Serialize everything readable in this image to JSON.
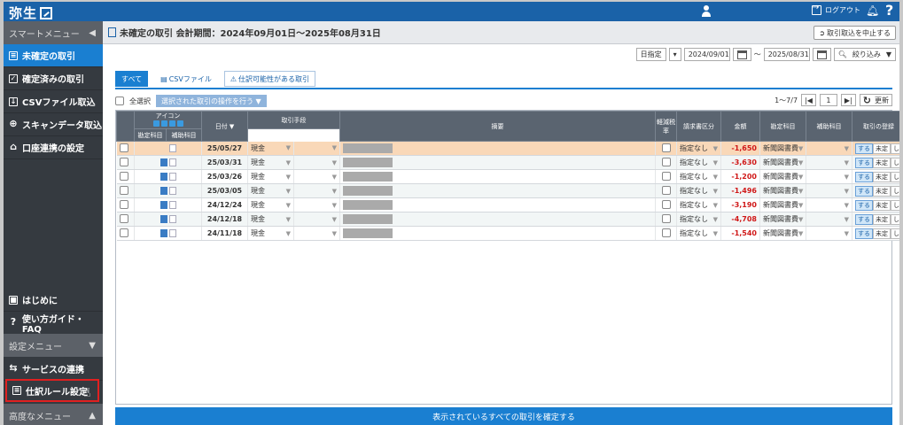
{
  "header": {
    "logo": "弥生",
    "logout_label": "ログアウト",
    "help_label": "?"
  },
  "sidebar": {
    "smart_menu": "スマートメニュー",
    "items": [
      {
        "label": "未確定の取引",
        "active": true
      },
      {
        "label": "確定済みの取引",
        "active": false
      },
      {
        "label": "CSVファイル取込",
        "active": false
      },
      {
        "label": "スキャンデータ取込",
        "active": false
      },
      {
        "label": "口座連携の設定",
        "active": false
      }
    ],
    "hajime": "はじめに",
    "guide": "使い方ガイド・FAQ",
    "settings_menu": "設定メニュー",
    "service": "サービスの連携",
    "rule": "仕訳ルール設定",
    "advanced_menu": "高度なメニュー"
  },
  "main": {
    "title": "未確定の取引 会計期間：2024年09月01日～2025年08月31日",
    "stop_button": "取引取込を中止する",
    "filter": {
      "field": "日指定",
      "from": "2024/09/01",
      "tilde": "～",
      "to": "2025/08/31",
      "search": "絞り込み"
    },
    "tabs": [
      "すべて",
      "CSVファイル",
      "仕訳可能性がある取引"
    ],
    "select_all": "全選択",
    "bulk_action": "選択された取引の操作を行う",
    "page_count": "1～7/7",
    "page_num": "1",
    "refresh": "更新",
    "confirm_all": "表示されているすべての取引を確定する"
  },
  "table": {
    "headers": {
      "icon": "アイコン",
      "date": "日付 ▼",
      "method": "取引手段",
      "account": "勘定科目",
      "sub": "補助科目",
      "summary": "摘要",
      "tax_short": "軽減税率",
      "invoice": "請求書区分",
      "amount": "金額",
      "account2": "勘定科目",
      "sub2": "補助科目",
      "register": "取引の登録"
    },
    "rows": [
      {
        "date": "25/05/27",
        "method": "現金",
        "invoice": "指定なし",
        "amount": "-1,650",
        "account": "新聞図書費",
        "selected": true
      },
      {
        "date": "25/03/31",
        "method": "現金",
        "invoice": "指定なし",
        "amount": "-3,630",
        "account": "新聞図書費",
        "selected": false
      },
      {
        "date": "25/03/26",
        "method": "現金",
        "invoice": "指定なし",
        "amount": "-1,200",
        "account": "新聞図書費",
        "selected": false
      },
      {
        "date": "25/03/05",
        "method": "現金",
        "invoice": "指定なし",
        "amount": "-1,496",
        "account": "新聞図書費",
        "selected": false
      },
      {
        "date": "24/12/24",
        "method": "現金",
        "invoice": "指定なし",
        "amount": "-3,190",
        "account": "新聞図書費",
        "selected": false
      },
      {
        "date": "24/12/18",
        "method": "現金",
        "invoice": "指定なし",
        "amount": "-4,708",
        "account": "新聞図書費",
        "selected": false
      },
      {
        "date": "24/11/18",
        "method": "現金",
        "invoice": "指定なし",
        "amount": "-1,540",
        "account": "新聞図書費",
        "selected": false
      }
    ],
    "register_labels": [
      "する",
      "未定",
      "しない"
    ]
  }
}
